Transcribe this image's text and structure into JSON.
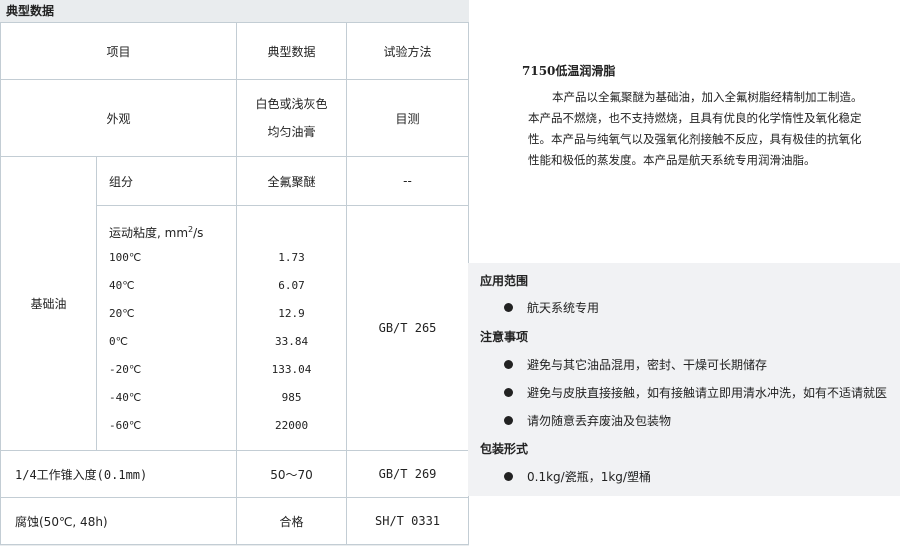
{
  "left": {
    "section_title": "典型数据",
    "table": {
      "headers": [
        "项目",
        "典型数据",
        "试验方法"
      ],
      "appearance": {
        "item": "外观",
        "value_line1": "白色或浅灰色",
        "value_line2": "均匀油膏",
        "method": "目测"
      },
      "base_oil": {
        "group_label": "基础油",
        "component": {
          "item": "组分",
          "value": "全氟聚醚",
          "method": "--"
        },
        "viscosity": {
          "label_prefix": "运动粘度, mm",
          "label_sup": "2",
          "label_suffix": "/s",
          "method": "GB/T 265",
          "rows": [
            {
              "temp": "100℃",
              "value": "1.73"
            },
            {
              "temp": "40℃",
              "value": "6.07"
            },
            {
              "temp": "20℃",
              "value": "12.9"
            },
            {
              "temp": "0℃",
              "value": "33.84"
            },
            {
              "temp": "-20℃",
              "value": "133.04"
            },
            {
              "temp": "-40℃",
              "value": "985"
            },
            {
              "temp": "-60℃",
              "value": "22000"
            }
          ]
        }
      },
      "cone_penetration": {
        "item": "1/4工作锥入度(0.1mm)",
        "value": "50～70",
        "method": "GB/T 269"
      },
      "corrosion": {
        "item": "腐蚀(50℃, 48h)",
        "value": "合格",
        "method": "SH/T 0331"
      }
    }
  },
  "product": {
    "title": "7150低温润滑脂",
    "description": "本产品以全氟聚醚为基础油，加入全氟树脂经精制加工制造。本产品不燃烧，也不支持燃烧，且具有优良的化学惰性及氧化稳定性。本产品与纯氧气以及强氧化剂接触不反应，具有极佳的抗氧化性能和极低的蒸发度。本产品是航天系统专用润滑油脂。"
  },
  "application": {
    "heading": "应用范围",
    "items": [
      "航天系统专用"
    ]
  },
  "notes": {
    "heading": "注意事项",
    "items": [
      "避免与其它油品混用，密封、干燥可长期储存",
      "避免与皮肤直接接触，如有接触请立即用清水冲洗，如有不适请就医",
      "请勿随意丢弃废油及包装物"
    ]
  },
  "packaging": {
    "heading": "包装形式",
    "items": [
      "0.1kg/瓷瓶，1kg/塑桶"
    ]
  }
}
